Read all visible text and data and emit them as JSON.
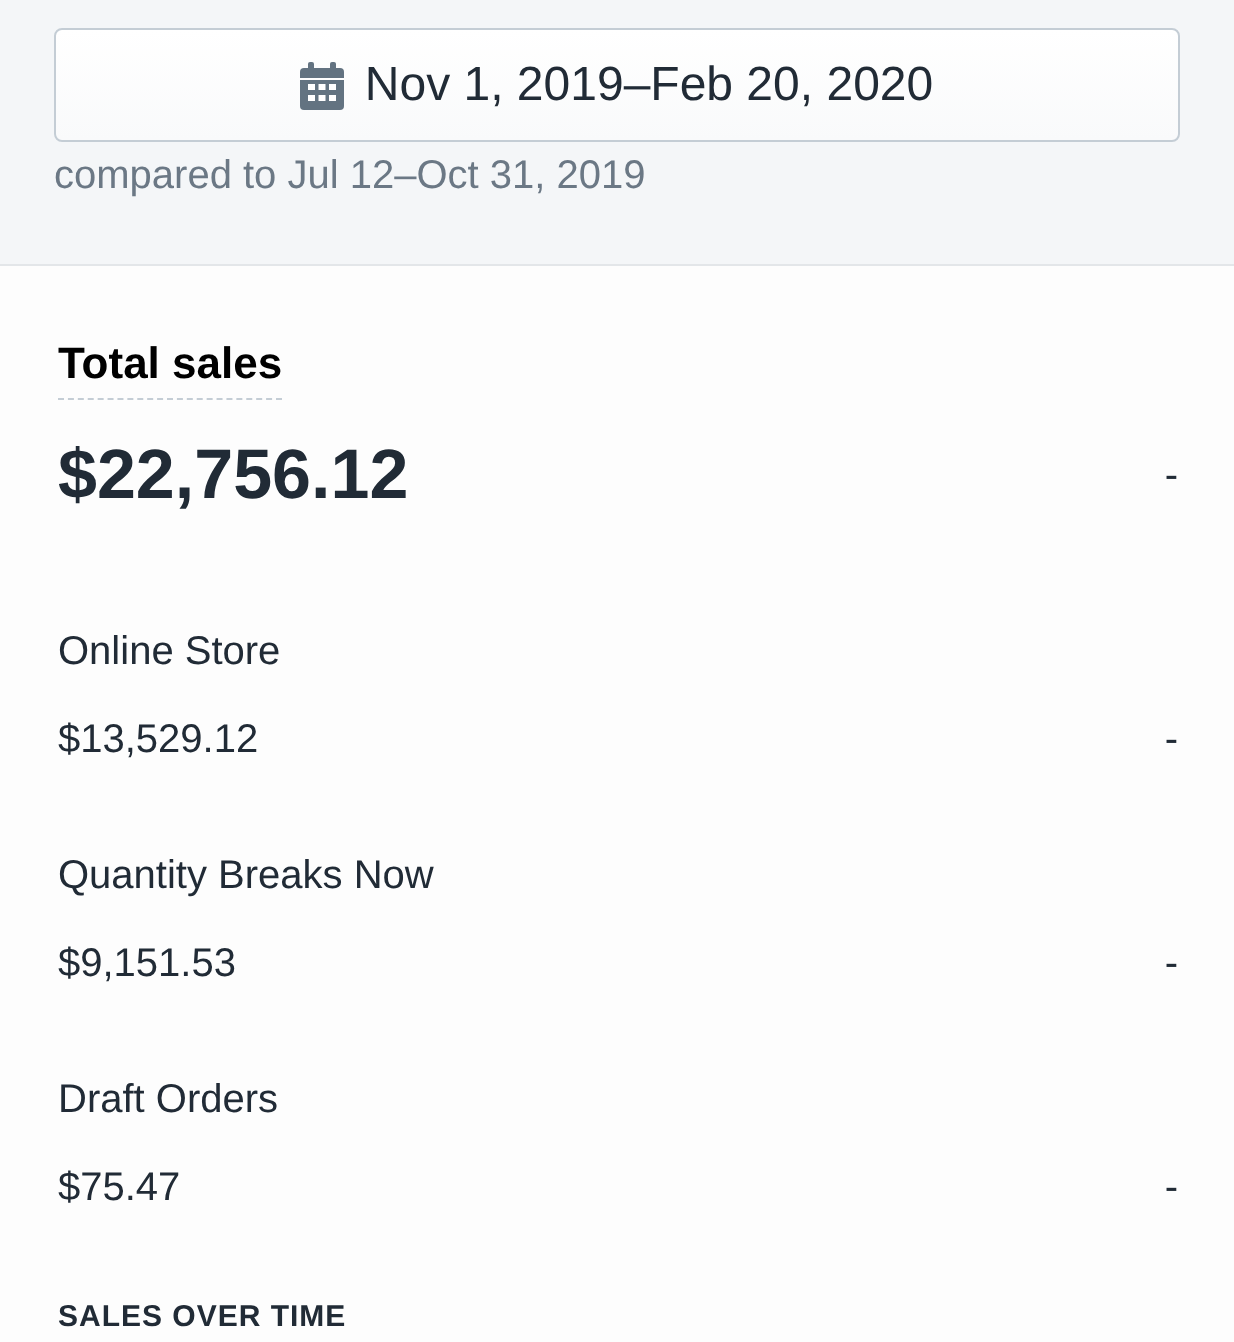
{
  "date_range": {
    "label": "Nov 1, 2019–Feb 20, 2020",
    "comparison": "compared to Jul 12–Oct 31, 2019"
  },
  "total_sales": {
    "title": "Total sales",
    "value": "$22,756.12",
    "change": "-"
  },
  "channels": [
    {
      "name": "Online Store",
      "value": "$13,529.12",
      "change": "-"
    },
    {
      "name": "Quantity Breaks Now",
      "value": "$9,151.53",
      "change": "-"
    },
    {
      "name": "Draft Orders",
      "value": "$75.47",
      "change": "-"
    }
  ],
  "next_section": {
    "title": "SALES OVER TIME"
  }
}
